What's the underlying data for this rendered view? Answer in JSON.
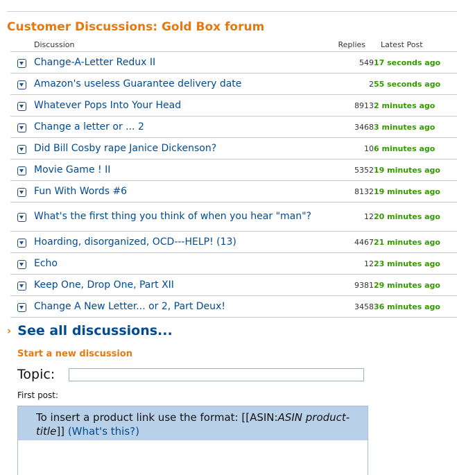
{
  "forum": {
    "title": "Customer Discussions: Gold Box forum"
  },
  "table": {
    "headers": {
      "discussion": "Discussion",
      "replies": "Replies",
      "latest": "Latest Post"
    },
    "rows": [
      {
        "title": "Change-A-Letter Redux II",
        "replies": "549",
        "latest": "17 seconds ago"
      },
      {
        "title": "Amazon's useless Guarantee delivery date",
        "replies": "2",
        "latest": "55 seconds ago"
      },
      {
        "title": "Whatever Pops Into Your Head",
        "replies": "8913",
        "latest": "2 minutes ago"
      },
      {
        "title": "Change a letter or ... 2",
        "replies": "3468",
        "latest": "3 minutes ago"
      },
      {
        "title": "Did Bill Cosby rape Janice Dickenson?",
        "replies": "10",
        "latest": "6 minutes ago"
      },
      {
        "title": "Movie Game ! II",
        "replies": "5352",
        "latest": "19 minutes ago"
      },
      {
        "title": "Fun With Words #6",
        "replies": "8132",
        "latest": "19 minutes ago"
      },
      {
        "title": "What's the first thing you think of when you hear \"man\"?",
        "replies": "12",
        "latest": "20 minutes ago"
      },
      {
        "title": "Hoarding, disorganized, OCD---HELP! (13)",
        "replies": "4467",
        "latest": "21 minutes ago"
      },
      {
        "title": "Echo",
        "replies": "12",
        "latest": "23 minutes ago"
      },
      {
        "title": "Keep One, Drop One, Part XII",
        "replies": "9381",
        "latest": "29 minutes ago"
      },
      {
        "title": "Change A New Letter... or 2, Part Deux!",
        "replies": "3458",
        "latest": "36 minutes ago"
      }
    ]
  },
  "see_all": {
    "arrow": "›",
    "label": "See all discussions..."
  },
  "new_discussion": {
    "heading": "Start a new discussion",
    "topic_label": "Topic:",
    "topic_value": "",
    "first_post_label": "First post:",
    "hint_prefix": "To insert a product link use the format: [[ASIN:",
    "hint_italic": "ASIN product-title",
    "hint_suffix": "]]",
    "hint_link": "(What's this?)",
    "post_value": ""
  },
  "colors": {
    "accent": "#e47911",
    "link": "#004b91",
    "time": "#339900",
    "hint_bg": "#b9d1e8"
  },
  "icons": {
    "row_menu": "chevron-down-icon"
  }
}
